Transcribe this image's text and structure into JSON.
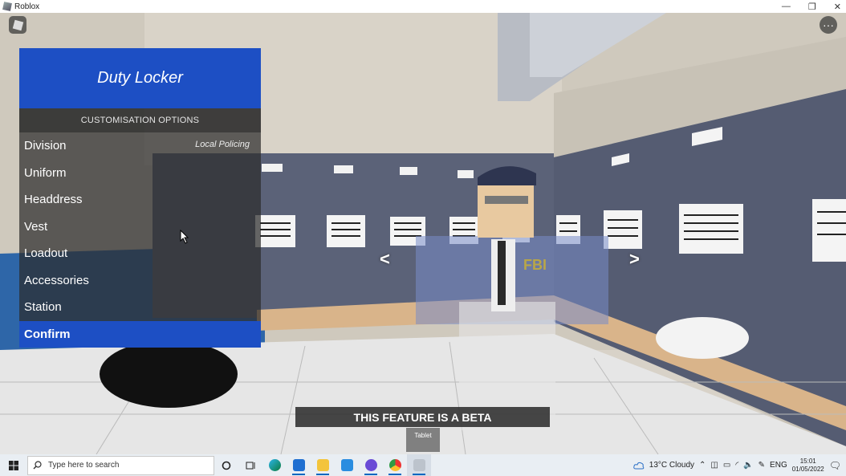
{
  "window": {
    "title": "Roblox",
    "controls": [
      "—",
      "❐",
      "✕"
    ]
  },
  "hud": {
    "menu_glyph": "···"
  },
  "locker": {
    "title": "Duty Locker",
    "subtitle": "CUSTOMISATION OPTIONS",
    "items": [
      {
        "label": "Division",
        "value": "Local Policing"
      },
      {
        "label": "Uniform"
      },
      {
        "label": "Headdress"
      },
      {
        "label": "Vest"
      },
      {
        "label": "Loadout"
      },
      {
        "label": "Accessories"
      },
      {
        "label": "Station"
      }
    ],
    "confirm_label": "Confirm"
  },
  "nav": {
    "prev": "<",
    "next": ">"
  },
  "banner": {
    "text": "THIS FEATURE IS A BETA"
  },
  "tablet": {
    "label": "Tablet"
  },
  "scene": {
    "vest_text": "FBI"
  },
  "taskbar": {
    "search_placeholder": "Type here to search",
    "weather": "13°C  Cloudy",
    "language": "ENG",
    "time": "15:01",
    "date": "01/05/2022"
  },
  "colors": {
    "panel_blue": "#1d4fc4",
    "locker_wall": "#5b6278",
    "taskbar": "#e9eef3"
  }
}
